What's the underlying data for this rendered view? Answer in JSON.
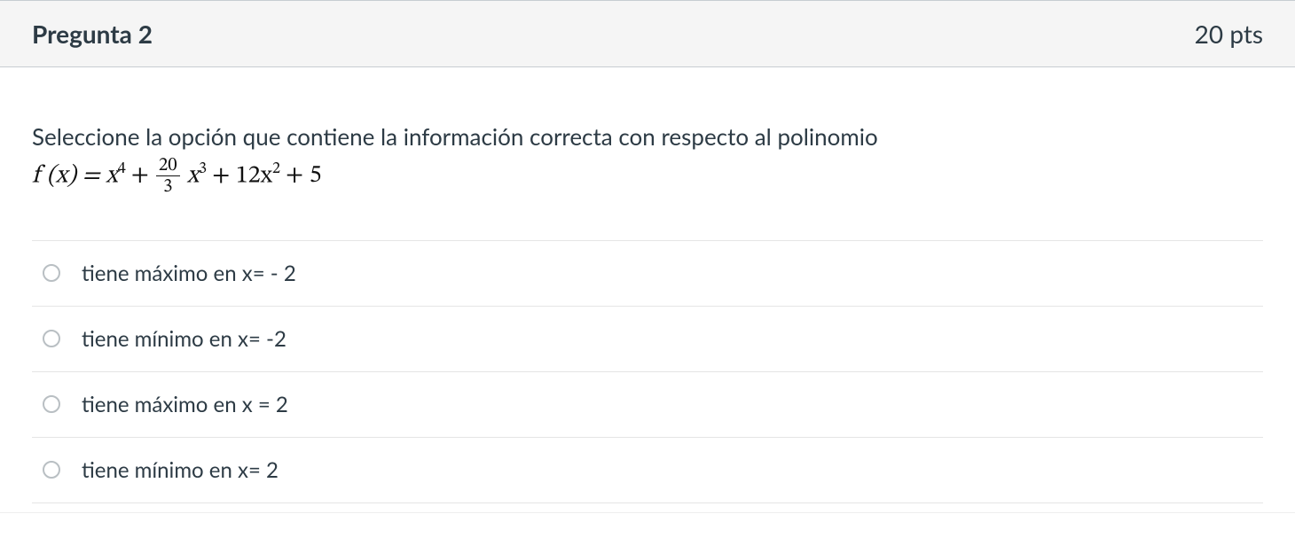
{
  "header": {
    "title": "Pregunta 2",
    "points": "20 pts"
  },
  "prompt": {
    "intro": "Seleccione la opción que contiene la información correcta con respecto al polinomio",
    "formula": {
      "lead": "f (x) = x",
      "exp1": "4",
      "plus1": " + ",
      "frac_num": "20",
      "frac_den": "3",
      "mid": "x",
      "exp2": "3",
      "plus2": " + 12x",
      "exp3": "2",
      "tail": " + 5"
    }
  },
  "options": [
    {
      "label": "tiene máximo en x= - 2"
    },
    {
      "label": "tiene mínimo en x= -2"
    },
    {
      "label": "tiene máximo en x = 2"
    },
    {
      "label": "tiene mínimo en x= 2"
    }
  ]
}
